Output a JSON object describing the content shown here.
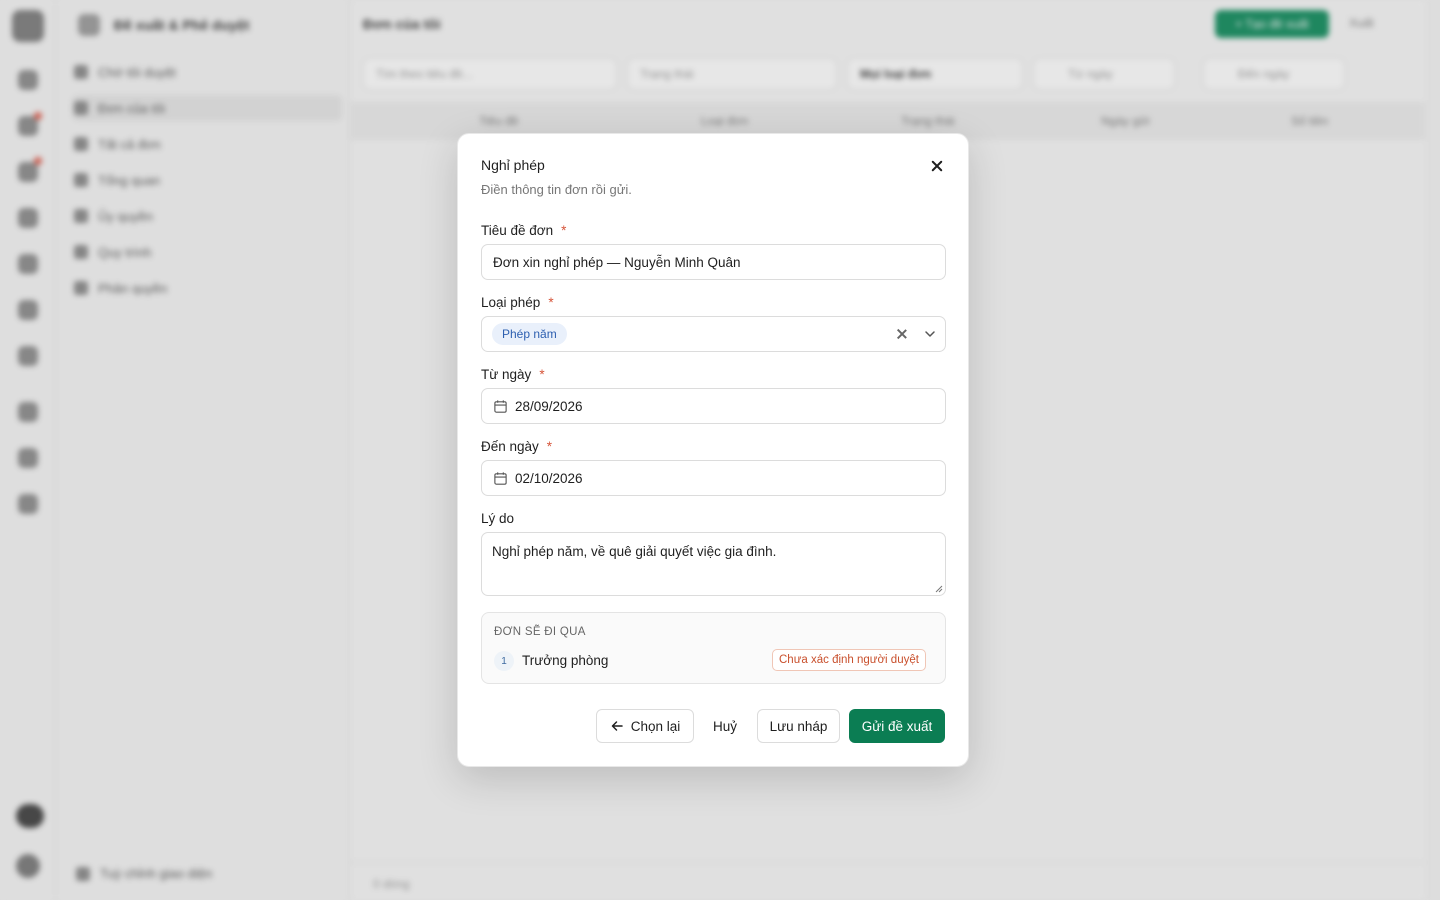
{
  "background": {
    "sidebar_title": "Đề xuất & Phê duyệt",
    "sidebar_items": [
      "Chờ tôi duyệt",
      "Đơn của tôi",
      "Tất cả đơn",
      "Tổng quan",
      "Ủy quyền",
      "Quy trình",
      "Phân quyền"
    ],
    "sidebar_footer": "Tuỳ chỉnh giao diện",
    "page_title": "Đơn của tôi",
    "new_button": "+ Tạo đề xuất",
    "export_button": "Xuất",
    "filters": {
      "search_placeholder": "Tìm theo tiêu đề...",
      "status_placeholder": "Trạng thái",
      "type_placeholder": "Mọi loại đơn",
      "from_placeholder": "Từ ngày",
      "to_placeholder": "Đến ngày"
    },
    "table_columns": [
      "Tiêu đề",
      "Loại đơn",
      "Trạng thái",
      "Ngày gửi",
      "Số tiền"
    ],
    "table_footer": "0 dòng"
  },
  "modal": {
    "title": "Nghỉ phép",
    "subtitle": "Điền thông tin đơn rồi gửi.",
    "fields": {
      "title_label": "Tiêu đề đơn",
      "title_value": "Đơn xin nghỉ phép — Nguyễn Minh Quân",
      "type_label": "Loại phép",
      "type_value": "Phép năm",
      "from_label": "Từ ngày",
      "from_value": "28/09/2026",
      "to_label": "Đến ngày",
      "to_value": "02/10/2026",
      "reason_label": "Lý do",
      "reason_value": "Nghỉ phép năm, về quê giải quyết việc gia đình."
    },
    "required_mark": "*",
    "route": {
      "title": "ĐƠN SẼ ĐI QUA",
      "steps": [
        {
          "num": "1",
          "name": "Trưởng phòng",
          "badge": "Chưa xác định người duyệt"
        }
      ]
    },
    "buttons": {
      "back": "Chọn lại",
      "cancel": "Huỷ",
      "draft": "Lưu nháp",
      "submit": "Gửi đề xuất"
    }
  },
  "colors": {
    "primary": "#0b7d53",
    "required": "#d6553a",
    "tag_bg": "#e9f0fb",
    "tag_text": "#2d5fb0",
    "warning_text": "#c9502d"
  }
}
